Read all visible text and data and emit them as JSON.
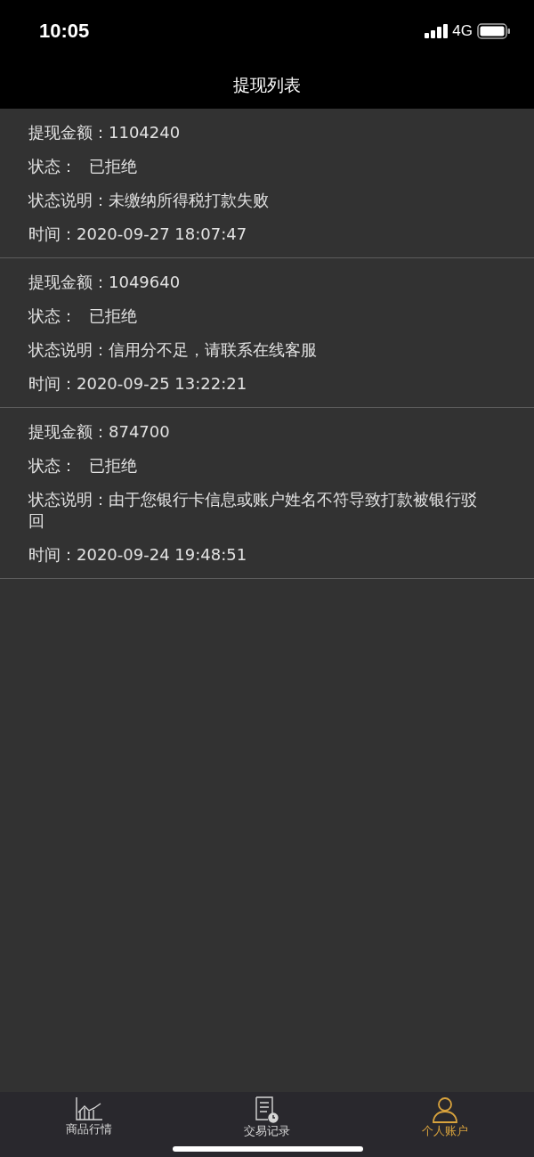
{
  "status_bar": {
    "time": "10:05",
    "network": "4G"
  },
  "header": {
    "title": "提现列表"
  },
  "records": [
    {
      "fields": [
        {
          "label": "提现金额：",
          "value": "1104240"
        },
        {
          "label": "状态：",
          "value": "已拒绝"
        },
        {
          "label": "状态说明：",
          "value": "未缴纳所得税打款失败"
        },
        {
          "label": "时间：",
          "value": "2020-09-27 18:07:47"
        }
      ]
    },
    {
      "fields": [
        {
          "label": "提现金额：",
          "value": "1049640"
        },
        {
          "label": "状态：",
          "value": "已拒绝"
        },
        {
          "label": "状态说明：",
          "value": "信用分不足，请联系在线客服"
        },
        {
          "label": "时间：",
          "value": "2020-09-25 13:22:21"
        }
      ]
    },
    {
      "fields": [
        {
          "label": "提现金额：",
          "value": "874700"
        },
        {
          "label": "状态：",
          "value": "已拒绝"
        },
        {
          "label": "状态说明：",
          "value": "由于您银行卡信息或账户姓名不符导致打款被银行驳回"
        },
        {
          "label": "时间：",
          "value": "2020-09-24 19:48:51"
        }
      ]
    }
  ],
  "tab_bar": [
    {
      "kind": "chart",
      "label": "商品行情",
      "selected": false
    },
    {
      "kind": "document",
      "label": "交易记录",
      "selected": false
    },
    {
      "kind": "person",
      "label": "个人账户",
      "selected": true
    }
  ]
}
